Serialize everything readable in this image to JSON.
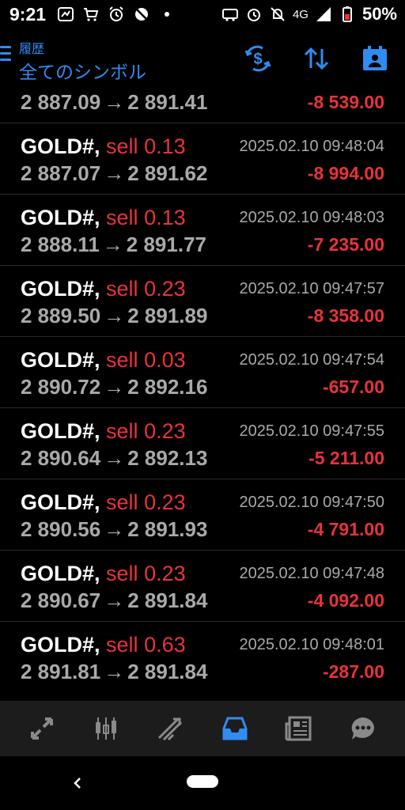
{
  "status_bar": {
    "time": "9:21",
    "network": "4G",
    "battery": "50%"
  },
  "header": {
    "subtitle": "履歴",
    "title": "全てのシンボル"
  },
  "trades": [
    {
      "symbol": "GOLD#,",
      "side": "sell",
      "volume": "0.13",
      "open_price": "2 887.07",
      "close_price": "2 891.62",
      "time": "2025.02.10 09:48:04",
      "profit": "-8 994.00"
    },
    {
      "symbol": "GOLD#,",
      "side": "sell",
      "volume": "0.13",
      "open_price": "2 888.11",
      "close_price": "2 891.77",
      "time": "2025.02.10 09:48:03",
      "profit": "-7 235.00"
    },
    {
      "symbol": "GOLD#,",
      "side": "sell",
      "volume": "0.23",
      "open_price": "2 889.50",
      "close_price": "2 891.89",
      "time": "2025.02.10 09:47:57",
      "profit": "-8 358.00"
    },
    {
      "symbol": "GOLD#,",
      "side": "sell",
      "volume": "0.03",
      "open_price": "2 890.72",
      "close_price": "2 892.16",
      "time": "2025.02.10 09:47:54",
      "profit": "-657.00"
    },
    {
      "symbol": "GOLD#,",
      "side": "sell",
      "volume": "0.23",
      "open_price": "2 890.64",
      "close_price": "2 892.13",
      "time": "2025.02.10 09:47:55",
      "profit": "-5 211.00"
    },
    {
      "symbol": "GOLD#,",
      "side": "sell",
      "volume": "0.23",
      "open_price": "2 890.56",
      "close_price": "2 891.93",
      "time": "2025.02.10 09:47:50",
      "profit": "-4 791.00"
    },
    {
      "symbol": "GOLD#,",
      "side": "sell",
      "volume": "0.23",
      "open_price": "2 890.67",
      "close_price": "2 891.84",
      "time": "2025.02.10 09:47:48",
      "profit": "-4 092.00"
    },
    {
      "symbol": "GOLD#,",
      "side": "sell",
      "volume": "0.63",
      "open_price": "2 891.81",
      "close_price": "2 891.84",
      "time": "2025.02.10 09:48:01",
      "profit": "-287.00"
    }
  ],
  "partial_trade": {
    "open_price": "2 887.09",
    "close_price": "2 891.41",
    "profit": "-8 539.00"
  },
  "arrow_glyph": "→",
  "icons": {
    "header": [
      "currency-exchange-icon",
      "sort-icon",
      "calendar-icon"
    ],
    "bottom_nav": [
      "quotes-icon",
      "chart-icon",
      "trade-icon",
      "history-icon",
      "news-icon",
      "chat-icon"
    ]
  },
  "colors": {
    "accent": "#2f8cf0",
    "loss": "#e8333a",
    "muted_text": "#a9a9a9",
    "nav_bg": "#1c1c1c"
  }
}
